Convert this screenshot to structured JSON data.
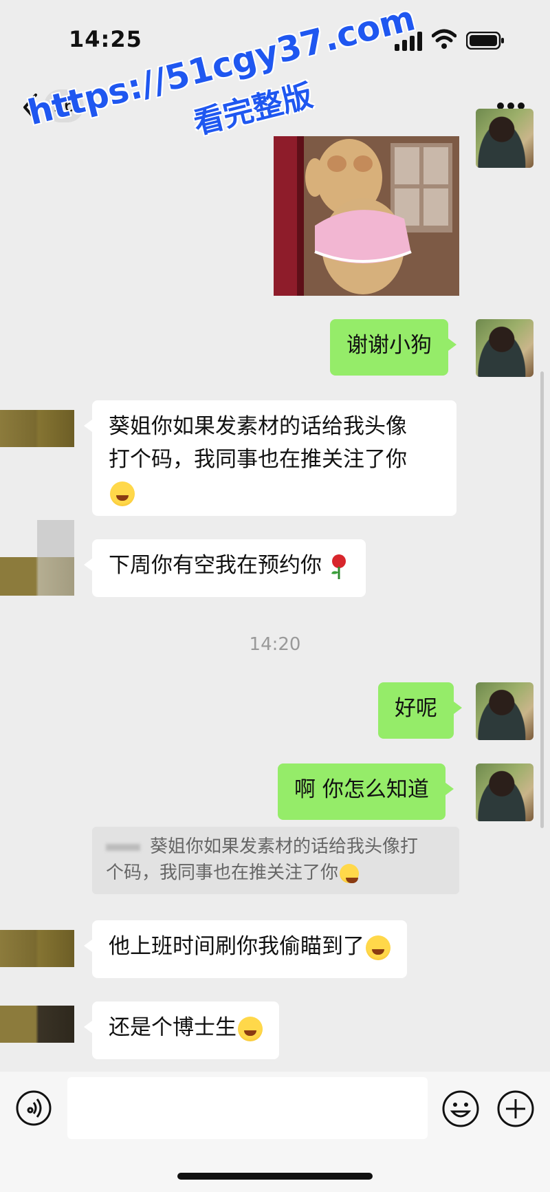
{
  "status_bar": {
    "time": "14:25"
  },
  "nav": {
    "unread_count": "16"
  },
  "watermark": {
    "line1": "https://51cgy37.com",
    "line2": "看完整版"
  },
  "messages": [
    {
      "text": "谢谢小狗"
    },
    {
      "text": "葵姐你如果发素材的话给我头像打个码，我同事也在推关注了你"
    },
    {
      "text": "下周你有空我在预约你"
    },
    {
      "text": "好呢"
    },
    {
      "text": "啊 你怎么知道"
    },
    {
      "text": "他上班时间刷你我偷瞄到了"
    },
    {
      "text": "还是个博士生"
    }
  ],
  "bubble_lines": {
    "m1_line1": "葵姐你如果发素材的话给我头像",
    "m1_line2": "打个码，我同事也在推关注了你"
  },
  "timestamp": "14:20",
  "quote": {
    "line1": "葵姐你如果发素材的话给我头像打",
    "line2": "个码，我同事也在推关注了你"
  },
  "icons": {
    "back": "chevron-left-icon",
    "more": "ellipsis-icon",
    "voice": "voice-icon",
    "emoji": "smiley-icon",
    "plus": "plus-circle-icon"
  },
  "colors": {
    "self_bubble": "#95ec69",
    "other_bubble": "#ffffff",
    "background": "#ededed",
    "watermark": "#1f57f0"
  }
}
